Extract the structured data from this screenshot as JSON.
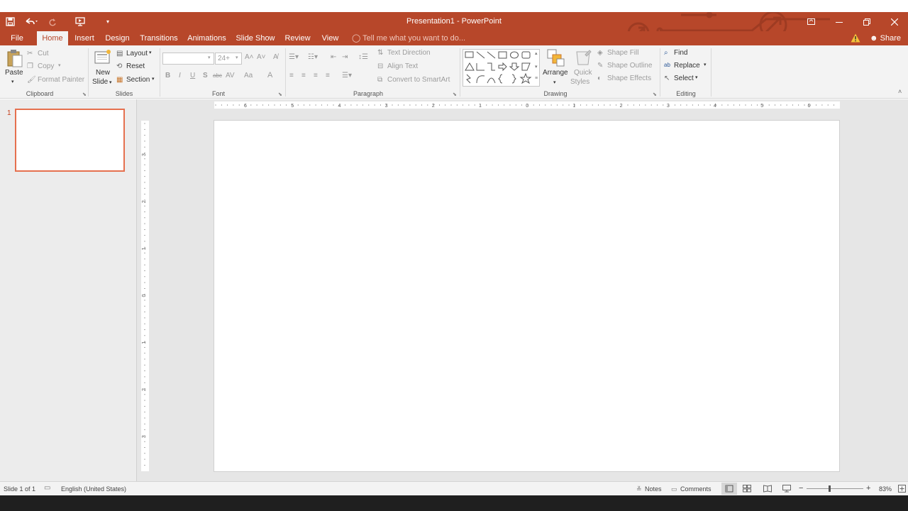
{
  "window": {
    "title": "Presentation1 - PowerPoint",
    "accent_color": "#b7472a",
    "minimize_icon": "minimize-icon",
    "restore_icon": "restore-icon",
    "close_icon": "close-icon",
    "ribbon_display_icon": "ribbon-display-options-icon"
  },
  "quick_access": {
    "save_icon": "save-icon",
    "undo_icon": "undo-icon",
    "redo_icon": "redo-icon",
    "start_from_beginning_icon": "present-icon",
    "customize_icon": "customize-dropdown-icon"
  },
  "tabs": [
    {
      "label": "File",
      "active": false
    },
    {
      "label": "Home",
      "active": true
    },
    {
      "label": "Insert",
      "active": false
    },
    {
      "label": "Design",
      "active": false
    },
    {
      "label": "Transitions",
      "active": false
    },
    {
      "label": "Animations",
      "active": false
    },
    {
      "label": "Slide Show",
      "active": false
    },
    {
      "label": "Review",
      "active": false
    },
    {
      "label": "View",
      "active": false
    }
  ],
  "tell_me": "Tell me what you want to do...",
  "share": "Share",
  "ribbon": {
    "clipboard": {
      "label": "Clipboard",
      "paste": "Paste",
      "cut": "Cut",
      "copy": "Copy",
      "format_painter": "Format Painter"
    },
    "slides": {
      "label": "Slides",
      "new_slide_1": "New",
      "new_slide_2": "Slide",
      "layout": "Layout",
      "reset": "Reset",
      "section": "Section"
    },
    "font": {
      "label": "Font",
      "font_name": "",
      "font_size": "24+",
      "bold": "B",
      "italic": "I",
      "underline": "U",
      "shadow": "S",
      "strike": "abc",
      "spacing": "AV",
      "case": "Aa",
      "color": "A"
    },
    "paragraph": {
      "label": "Paragraph",
      "text_direction": "Text Direction",
      "align_text": "Align Text",
      "convert_smartart": "Convert to SmartArt"
    },
    "drawing": {
      "label": "Drawing",
      "arrange": "Arrange",
      "quick_styles_1": "Quick",
      "quick_styles_2": "Styles",
      "shape_fill": "Shape Fill",
      "shape_outline": "Shape Outline",
      "shape_effects": "Shape Effects"
    },
    "editing": {
      "label": "Editing",
      "find": "Find",
      "replace": "Replace",
      "select": "Select"
    }
  },
  "thumbnails": [
    {
      "number": "1"
    }
  ],
  "ruler": {
    "horizontal": [
      "6",
      "5",
      "4",
      "3",
      "2",
      "1",
      "0",
      "1",
      "2",
      "3",
      "4",
      "5",
      "6"
    ],
    "vertical": [
      "3",
      "2",
      "1",
      "0",
      "1",
      "2",
      "3"
    ]
  },
  "status": {
    "slide_info": "Slide 1 of 1",
    "language": "English (United States)",
    "notes": "Notes",
    "comments": "Comments",
    "zoom": "83%",
    "zoom_minus": "−",
    "zoom_plus": "+"
  }
}
